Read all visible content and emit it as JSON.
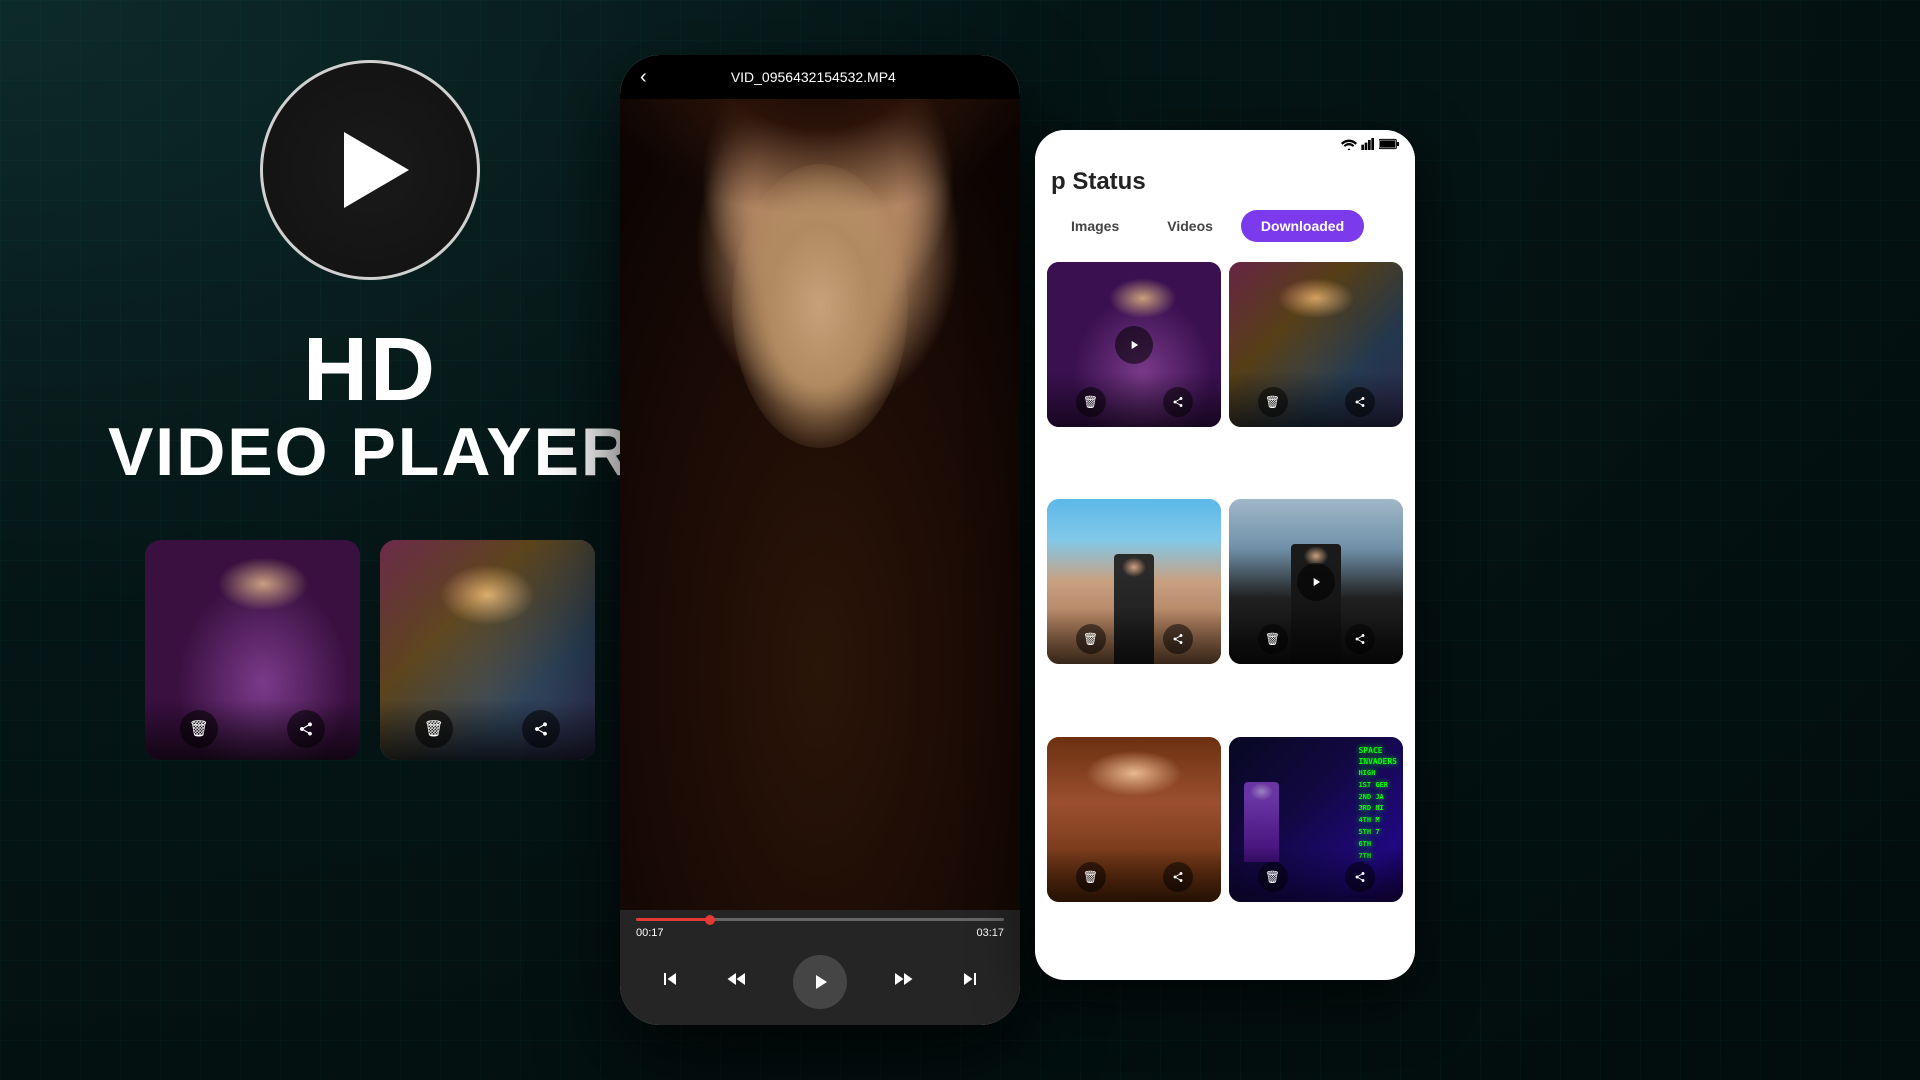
{
  "app": {
    "title_line1": "HD",
    "title_line2": "VIDEO PLAYER",
    "background_color": "#051515"
  },
  "video_player": {
    "filename": "VID_0956432154532.MP4",
    "current_time": "00:17",
    "total_time": "03:17",
    "progress_percent": 20
  },
  "right_panel": {
    "title": "p Status",
    "tabs": [
      {
        "label": "Images",
        "active": false
      },
      {
        "label": "Videos",
        "active": false
      },
      {
        "label": "Downloaded",
        "active": true
      }
    ]
  },
  "bottom_thumbnails": [
    {
      "id": "thumb1",
      "style": "purple"
    },
    {
      "id": "thumb2",
      "style": "colorful"
    }
  ],
  "controls": {
    "play_label": "▶",
    "rewind_label": "⏮",
    "fast_rewind_label": "⏪",
    "fast_forward_label": "⏩",
    "skip_label": "⏭",
    "back_label": "‹"
  },
  "icons": {
    "trash": "🗑",
    "share": "↗",
    "play": "▶",
    "wifi": "▼",
    "signal": "▐",
    "battery": "▮"
  },
  "grid_items": [
    {
      "id": "g1",
      "type": "purple",
      "has_play": true
    },
    {
      "id": "g2",
      "type": "colorful",
      "has_play": false
    },
    {
      "id": "g3",
      "type": "outdoor",
      "has_play": false
    },
    {
      "id": "g4",
      "type": "fashion",
      "has_play": true
    },
    {
      "id": "g5",
      "type": "warm",
      "has_play": false
    },
    {
      "id": "g6",
      "type": "neon",
      "has_play": false
    }
  ],
  "space_invaders_text": "HIGH\n1ST GER\n2ND JA\n3RD HI\n4TH M\n5TH 7\n6TH\n7TH"
}
